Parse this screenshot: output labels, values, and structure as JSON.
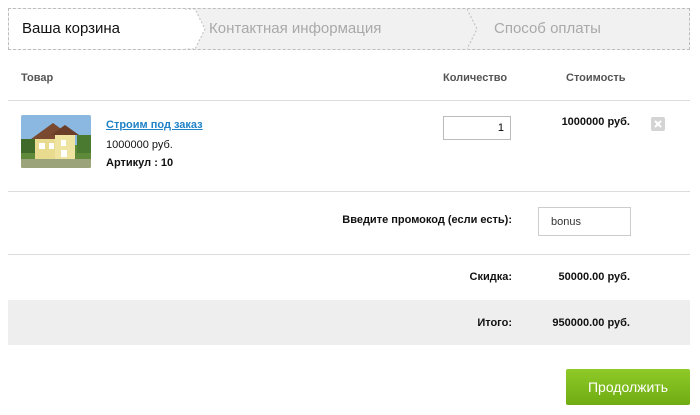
{
  "steps": [
    {
      "label": "Ваша корзина",
      "active": true
    },
    {
      "label": "Контактная информация",
      "active": false
    },
    {
      "label": "Способ оплаты",
      "active": false
    }
  ],
  "table": {
    "headers": {
      "product": "Товар",
      "quantity": "Количество",
      "cost": "Стоимость"
    }
  },
  "item": {
    "name": "Строим под заказ",
    "price": "1000000 руб.",
    "sku_label": "Артикул : ",
    "sku": "10",
    "quantity": "1",
    "cost": "1000000 руб.",
    "image": "house-photo"
  },
  "promo": {
    "label": "Введите промокод (если есть):",
    "value": "bonus"
  },
  "discount": {
    "label": "Скидка:",
    "value": "50000.00 руб."
  },
  "total": {
    "label": "Итого:",
    "value": "950000.00 руб."
  },
  "continue_label": "Продолжить",
  "colors": {
    "accent_green": "#7cb81c",
    "link": "#1f82c6"
  }
}
